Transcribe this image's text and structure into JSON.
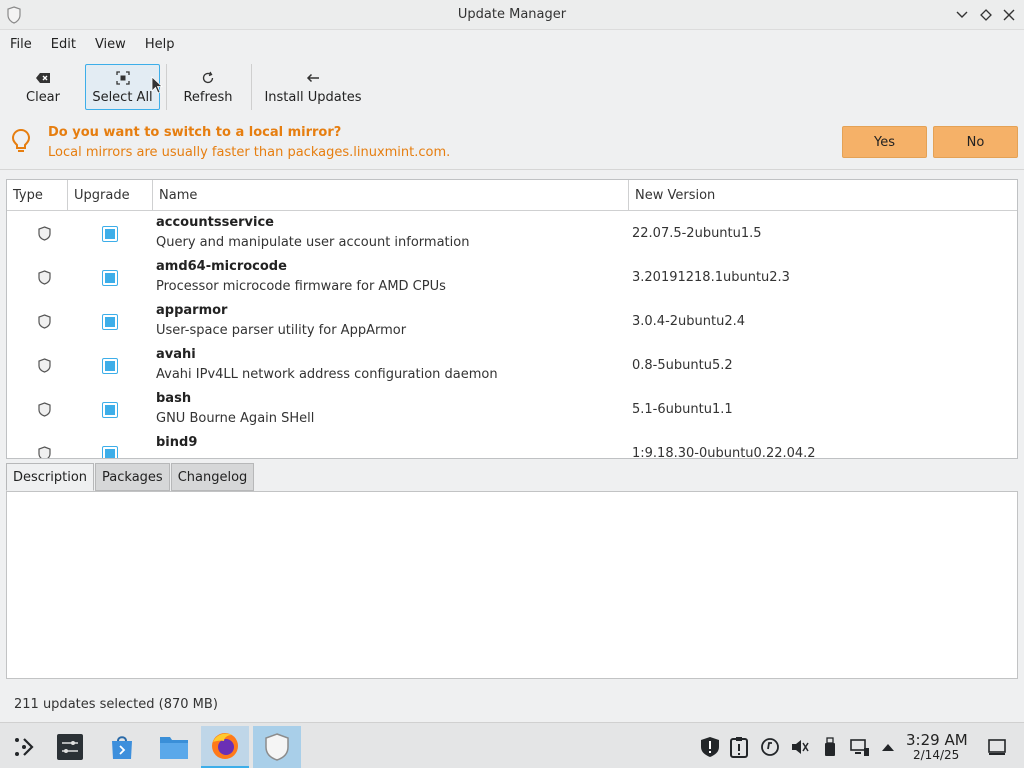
{
  "window": {
    "title": "Update Manager"
  },
  "menu": [
    "File",
    "Edit",
    "View",
    "Help"
  ],
  "toolbar": {
    "clear": "Clear",
    "select_all": "Select All",
    "refresh": "Refresh",
    "install": "Install Updates"
  },
  "infobar": {
    "title": "Do you want to switch to a local mirror?",
    "subtitle": "Local mirrors are usually faster than packages.linuxmint.com.",
    "yes": "Yes",
    "no": "No",
    "accent": "#e67e10",
    "button_color": "#f5b168"
  },
  "table": {
    "columns": [
      "Type",
      "Upgrade",
      "Name",
      "New Version"
    ],
    "rows": [
      {
        "name": "accountsservice",
        "desc": "Query and manipulate user account information",
        "version": "22.07.5-2ubuntu1.5",
        "checked": true
      },
      {
        "name": "amd64-microcode",
        "desc": "Processor microcode firmware for AMD CPUs",
        "version": "3.20191218.1ubuntu2.3",
        "checked": true
      },
      {
        "name": "apparmor",
        "desc": "User-space parser utility for AppArmor",
        "version": "3.0.4-2ubuntu2.4",
        "checked": true
      },
      {
        "name": "avahi",
        "desc": "Avahi IPv4LL network address configuration daemon",
        "version": "0.8-5ubuntu5.2",
        "checked": true
      },
      {
        "name": "bash",
        "desc": "GNU Bourne Again SHell",
        "version": "5.1-6ubuntu1.1",
        "checked": true
      },
      {
        "name": "bind9",
        "desc": "",
        "version": "1:9.18.30-0ubuntu0.22.04.2",
        "checked": true
      }
    ]
  },
  "tabs": [
    "Description",
    "Packages",
    "Changelog"
  ],
  "status": "211 updates selected (870 MB)",
  "clock": {
    "time": "3:29 AM",
    "date": "2/14/25"
  },
  "colors": {
    "accent": "#3daee9"
  }
}
